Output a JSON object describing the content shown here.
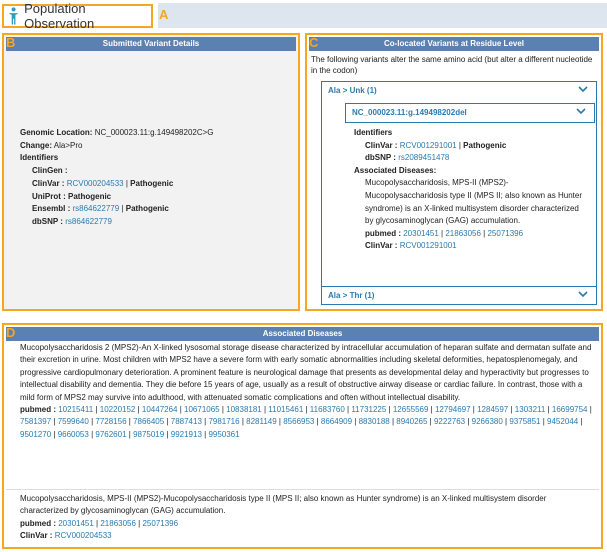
{
  "header": {
    "title": "Population Observation",
    "label": "A"
  },
  "panels": {
    "b": {
      "label": "B",
      "title": "Submitted Variant Details"
    },
    "c": {
      "label": "C",
      "title": "Co-located Variants at Residue Level"
    },
    "d": {
      "label": "D",
      "title": "Associated Diseases"
    }
  },
  "variant": {
    "genomic_location_label": "Genomic Location:",
    "genomic_location": "NC_000023.11:g.149498202C>G",
    "change_label": "Change:",
    "change": "Ala>Pro",
    "identifiers_label": "Identifiers",
    "clingen_label": "ClinGen :",
    "clinvar_label": "ClinVar :",
    "clinvar_id": "RCV000204533",
    "clinvar_sig": "Pathogenic",
    "uniprot_label": "UniProt :",
    "uniprot_sig": "Pathogenic",
    "ensembl_label": "Ensembl :",
    "ensembl_id": "rs864622779",
    "ensembl_sig": "Pathogenic",
    "dbsnp_label": "dbSNP :",
    "dbsnp_id": "rs864622779",
    "pipe": "|"
  },
  "colocated": {
    "intro": "The following variants alter the same amino acid (but alter a different nucleotide in the codon)",
    "acc1": "Ala > Unk (1)",
    "acc1_sub": "NC_000023.11:g.149498202del",
    "identifiers_label": "Identifiers",
    "clinvar_label": "ClinVar :",
    "clinvar_id": "RCV001291001",
    "clinvar_sig": "Pathogenic",
    "dbsnp_label": "dbSNP :",
    "dbsnp_id": "rs2089451478",
    "assoc_label": "Associated Diseases:",
    "disease_text": "Mucopolysaccharidosis, MPS-II (MPS2)-Mucopolysaccharidosis type II (MPS II; also known as Hunter syndrome) is an X-linked multisystem disorder characterized by glycosaminoglycan (GAG) accumulation.",
    "pubmed_label": "pubmed :",
    "pubmed_ids": [
      "20301451",
      "21863056",
      "25071396"
    ],
    "clinvar2_label": "ClinVar :",
    "clinvar2_id": "RCV001291001",
    "acc2": "Ala > Thr (1)"
  },
  "diseases": {
    "d1_text": "Mucopolysaccharidosis 2 (MPS2)-An X-linked lysosomal storage disease characterized by intracellular accumulation of heparan sulfate and dermatan sulfate and their excretion in urine. Most children with MPS2 have a severe form with early somatic abnormalities including skeletal deformities, hepatosplenomegaly, and progressive cardiopulmonary deterioration. A prominent feature is neurological damage that presents as developmental delay and hyperactivity but progresses to intellectual disability and dementia. They die before 15 years of age, usually as a result of obstructive airway disease or cardiac failure. In contrast, those with a mild form of MPS2 may survive into adulthood, with attenuated somatic complications and often without intellectual disability.",
    "pubmed_label": "pubmed :",
    "d1_pubmed": [
      "10215411",
      "10220152",
      "10447264",
      "10671065",
      "10838181",
      "11015461",
      "11683760",
      "11731225",
      "12655569",
      "12794697",
      "1284597",
      "1303211",
      "16699754",
      "7581397",
      "7599640",
      "7728156",
      "7866405",
      "7887413",
      "7981716",
      "8281149",
      "8566953",
      "8664909",
      "8830188",
      "8940265",
      "9222763",
      "9266380",
      "9375851",
      "9452044",
      "9501270",
      "9660053",
      "9762601",
      "9875019",
      "9921913",
      "9950361"
    ],
    "d2_text": "Mucopolysaccharidosis, MPS-II (MPS2)-Mucopolysaccharidosis type II (MPS II; also known as Hunter syndrome) is an X-linked multisystem disorder characterized by glycosaminoglycan (GAG) accumulation.",
    "d2_pubmed": [
      "20301451",
      "21863056",
      "25071396"
    ],
    "clinvar_label": "ClinVar :",
    "clinvar_id": "RCV000204533"
  },
  "colors": {
    "accent": "#f5a623",
    "header_blue": "#5b80b2",
    "link": "#2a7ab0"
  }
}
